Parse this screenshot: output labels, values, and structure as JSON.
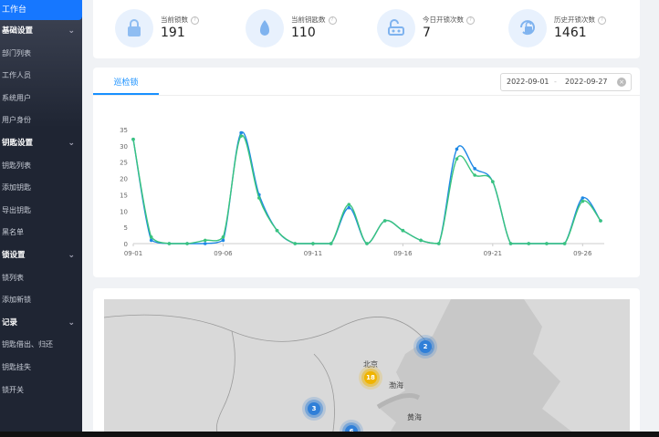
{
  "sidebar": {
    "active": "工作台",
    "rows": [
      {
        "label": "基础设置",
        "group": true
      },
      {
        "label": "部门列表",
        "group": false
      },
      {
        "label": "工作人员",
        "group": false
      },
      {
        "label": "系统用户",
        "group": false
      },
      {
        "label": "用户身份",
        "group": false
      },
      {
        "label": "钥匙设置",
        "group": true
      },
      {
        "label": "钥匙列表",
        "group": false
      },
      {
        "label": "添加钥匙",
        "group": false
      },
      {
        "label": "导出钥匙",
        "group": false
      },
      {
        "label": "黑名单",
        "group": false
      },
      {
        "label": "锁设置",
        "group": true
      },
      {
        "label": "锁列表",
        "group": false
      },
      {
        "label": "添加新锁",
        "group": false
      },
      {
        "label": "记录",
        "group": true
      },
      {
        "label": "钥匙借出、归还",
        "group": false
      },
      {
        "label": "钥匙挂失",
        "group": false
      },
      {
        "label": "锁开关",
        "group": false
      }
    ]
  },
  "stats": [
    {
      "label": "当前锁数",
      "value": "191",
      "icon": "lock-icon"
    },
    {
      "label": "当前钥匙数",
      "value": "110",
      "icon": "key-icon"
    },
    {
      "label": "今日开锁次数",
      "value": "7",
      "icon": "unlock-key-icon"
    },
    {
      "label": "历史开锁次数",
      "value": "1461",
      "icon": "unlock-history-icon"
    }
  ],
  "chart_panel": {
    "tab": "巡检锁",
    "date_start": "2022-09-01",
    "date_sep": "-",
    "date_end": "2022-09-27"
  },
  "map": {
    "labels": [
      "北京",
      "渤海",
      "黄海"
    ],
    "clusters": [
      {
        "count": "2",
        "color": "blue"
      },
      {
        "count": "18",
        "color": "yellow"
      },
      {
        "count": "3",
        "color": "blue"
      },
      {
        "count": "6",
        "color": "blue"
      }
    ]
  },
  "colors": {
    "accent": "#1890ff",
    "sidebar": "#1f2533",
    "series1": "#1e88e5",
    "series2": "#3ac47d"
  },
  "chart_data": {
    "type": "line",
    "x": [
      "09-01",
      "09-02",
      "09-03",
      "09-04",
      "09-05",
      "09-06",
      "09-07",
      "09-08",
      "09-09",
      "09-10",
      "09-11",
      "09-12",
      "09-13",
      "09-14",
      "09-15",
      "09-16",
      "09-17",
      "09-18",
      "09-19",
      "09-20",
      "09-21",
      "09-22",
      "09-23",
      "09-24",
      "09-25",
      "09-26",
      "09-27"
    ],
    "xticks": [
      "09-01",
      "09-06",
      "09-11",
      "09-16",
      "09-21",
      "09-26"
    ],
    "yticks": [
      "0",
      "5",
      "10",
      "15",
      "20",
      "25",
      "30",
      "35"
    ],
    "ylim": [
      0,
      35
    ],
    "series": [
      {
        "values": [
          32,
          1,
          0,
          0,
          0,
          1,
          34,
          15,
          4,
          0,
          0,
          0,
          11,
          0,
          7,
          4,
          1,
          0,
          29,
          23,
          19,
          0,
          0,
          0,
          0,
          14,
          7
        ]
      },
      {
        "values": [
          32,
          2,
          0,
          0,
          1,
          2,
          33,
          14,
          4,
          0,
          0,
          0,
          12,
          0,
          7,
          4,
          1,
          0,
          26,
          21,
          19,
          0,
          0,
          0,
          0,
          13,
          7
        ]
      }
    ],
    "grid": false,
    "legend": "none"
  }
}
